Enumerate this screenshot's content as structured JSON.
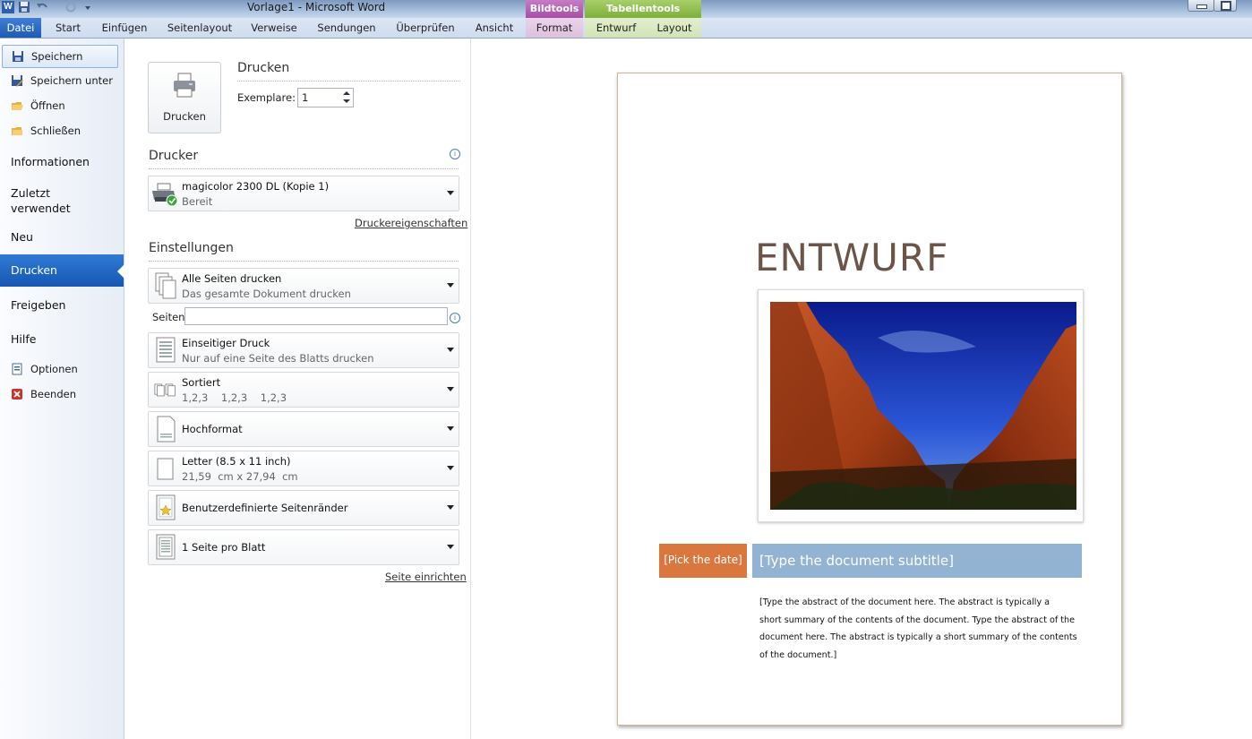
{
  "window": {
    "title": "Vorlage1  -  Microsoft Word"
  },
  "ribbon": {
    "file_tab": "Datei",
    "tabs": [
      "Start",
      "Einfügen",
      "Seitenlayout",
      "Verweise",
      "Sendungen",
      "Überprüfen",
      "Ansicht",
      "Format",
      "Entwurf",
      "Layout"
    ],
    "context_groups": [
      "Bildtools",
      "Tabellentools"
    ]
  },
  "backstage_nav": {
    "save": "Speichern",
    "save_as": "Speichern unter",
    "open": "Öffnen",
    "close": "Schließen",
    "info": "Informationen",
    "recent": "Zuletzt verwendet",
    "new": "Neu",
    "print": "Drucken",
    "share": "Freigeben",
    "help": "Hilfe",
    "options": "Optionen",
    "exit": "Beenden"
  },
  "print_panel": {
    "print_button": "Drucken",
    "heading": "Drucken",
    "copies_label": "Exemplare:",
    "copies_value": "1",
    "printer_heading": "Drucker",
    "printer_name": "magicolor 2300 DL (Kopie 1)",
    "printer_status": "Bereit",
    "printer_properties": "Druckereigenschaften",
    "settings_heading": "Einstellungen",
    "pages_label": "Seiten:",
    "pages_value": "",
    "settings": [
      {
        "title": "Alle Seiten drucken",
        "subtitle": "Das gesamte Dokument drucken"
      },
      {
        "title": "Einseitiger Druck",
        "subtitle": "Nur auf eine Seite des Blatts drucken"
      },
      {
        "title": "Sortiert",
        "subtitle": "1,2,3    1,2,3    1,2,3"
      },
      {
        "title": "Hochformat",
        "subtitle": ""
      },
      {
        "title": "Letter (8.5 x 11 inch)",
        "subtitle": "21,59  cm x 27,94  cm"
      },
      {
        "title": "Benutzerdefinierte Seitenränder",
        "subtitle": ""
      },
      {
        "title": "1 Seite pro Blatt",
        "subtitle": ""
      }
    ],
    "page_setup": "Seite einrichten"
  },
  "document_preview": {
    "title": "ENTWURF",
    "date_placeholder": "[Pick the date]",
    "subtitle_placeholder": "[Type the document subtitle]",
    "abstract_lines": [
      "[Type the abstract of the document here. The abstract is typically a",
      "short summary of the contents of the document. Type the abstract of the",
      "document here. The abstract is typically a short summary of the contents",
      "of the document.]"
    ]
  },
  "colors": {
    "accent_blue": "#1f5bb5",
    "date_bar": "#d9773f",
    "subtitle_bar": "#93b3d2",
    "title_text": "#6b5548"
  }
}
